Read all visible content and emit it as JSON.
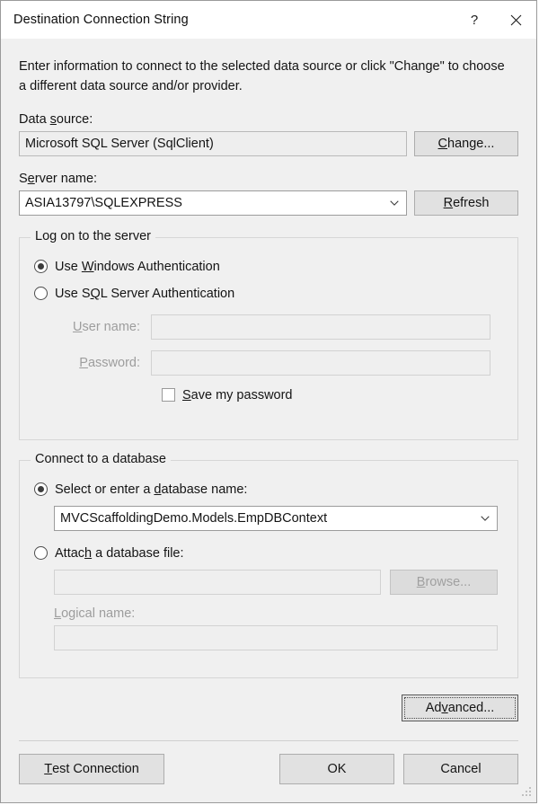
{
  "window": {
    "title": "Destination Connection String",
    "help_label": "?",
    "close_label": "Close",
    "help_icon": "question-mark-icon",
    "close_icon": "close-x-icon"
  },
  "intro": {
    "text": "Enter information to connect to the selected data source or click \"Change\" to choose a different data source and/or provider."
  },
  "data_source": {
    "label_pre": "Data ",
    "label_accel": "s",
    "label_post": "ource:",
    "value": "Microsoft SQL Server (SqlClient)",
    "change_button_pre": "",
    "change_button_accel": "C",
    "change_button_post": "hange..."
  },
  "server": {
    "label_pre": "S",
    "label_accel": "e",
    "label_post": "rver name:",
    "value": "ASIA13797\\SQLEXPRESS",
    "dropdown_icon": "chevron-down-icon",
    "refresh_button_pre": "",
    "refresh_button_accel": "R",
    "refresh_button_post": "efresh"
  },
  "logon_group": {
    "title": "Log on to the server",
    "windows_auth": {
      "pre": "Use ",
      "accel": "W",
      "post": "indows Authentication",
      "selected": true
    },
    "sql_auth": {
      "pre": "Use S",
      "accel": "Q",
      "post": "L Server Authentication",
      "selected": false
    },
    "username": {
      "label_pre": "",
      "label_accel": "U",
      "label_post": "ser name:",
      "value": "",
      "disabled": true
    },
    "password": {
      "label_pre": "",
      "label_accel": "P",
      "label_post": "assword:",
      "value": "",
      "disabled": true
    },
    "save_password": {
      "pre": "",
      "accel": "S",
      "post": "ave my password",
      "checked": false
    }
  },
  "database_group": {
    "title": "Connect to a database",
    "select_db": {
      "pre": "Select or enter a ",
      "accel": "d",
      "post": "atabase name:",
      "selected": true
    },
    "db_name": {
      "value": "MVCScaffoldingDemo.Models.EmpDBContext",
      "dropdown_icon": "chevron-down-icon"
    },
    "attach_db": {
      "pre": "Attac",
      "accel": "h",
      "post": " a database file:",
      "selected": false
    },
    "attach_path": {
      "value": "",
      "disabled": true
    },
    "browse_button": {
      "pre": "",
      "accel": "B",
      "post": "rowse...",
      "disabled": true
    },
    "logical_name": {
      "label_pre": "",
      "label_accel": "L",
      "label_post": "ogical name:",
      "value": "",
      "disabled": true
    }
  },
  "advanced_button": {
    "pre": "Ad",
    "accel": "v",
    "post": "anced...",
    "focused": true
  },
  "footer": {
    "test_connection": {
      "pre": "",
      "accel": "T",
      "post": "est Connection"
    },
    "ok": "OK",
    "cancel": "Cancel"
  }
}
